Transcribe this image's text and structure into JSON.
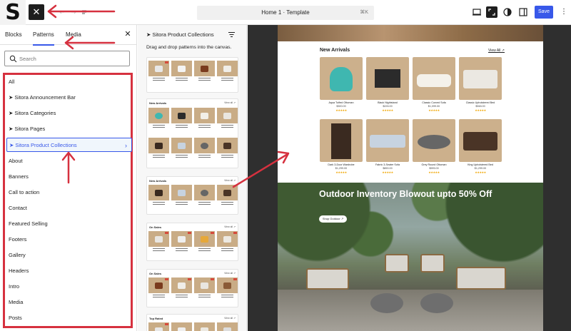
{
  "topbar": {
    "logo_letter": "S",
    "close_glyph": "✕",
    "document_title": "Home 1 · Template",
    "shortcut": "⌘K",
    "save_label": "Save",
    "more_glyph": "⋮",
    "icons": [
      "view-desktop-icon",
      "zoom-out-icon",
      "styles-icon",
      "settings-sidebar-icon"
    ]
  },
  "inserter": {
    "tabs": [
      {
        "label": "Blocks",
        "active": false
      },
      {
        "label": "Patterns",
        "active": true
      },
      {
        "label": "Media",
        "active": false
      }
    ],
    "close_glyph": "✕",
    "search": {
      "placeholder": "Search",
      "value": ""
    },
    "categories": [
      {
        "label": "All"
      },
      {
        "label": "➤ Sitora Announcement Bar"
      },
      {
        "label": "➤ Sitora Categories"
      },
      {
        "label": "➤ Sitora Pages"
      },
      {
        "label": "➤ Sitora Product Collections",
        "selected": true
      },
      {
        "label": "About"
      },
      {
        "label": "Banners"
      },
      {
        "label": "Call to action"
      },
      {
        "label": "Contact"
      },
      {
        "label": "Featured Selling"
      },
      {
        "label": "Footers"
      },
      {
        "label": "Gallery"
      },
      {
        "label": "Headers"
      },
      {
        "label": "Intro"
      },
      {
        "label": "Media"
      },
      {
        "label": "Posts"
      }
    ],
    "chevron_glyph": "›"
  },
  "patterns_panel": {
    "title": "➤ Sitora Product Collections",
    "help_text": "Drag and drop patterns into the canvas.",
    "cards": [
      {
        "title": "",
        "link": ""
      },
      {
        "title": "New Arrivals",
        "link": "View all ↗"
      },
      {
        "title": "New Arrivals",
        "link": "View all ↗"
      },
      {
        "title": "On Sales",
        "link": "View all ↗"
      },
      {
        "title": "On Sales",
        "link": "View all ↗"
      },
      {
        "title": "Top Rated",
        "link": "View all ↗"
      }
    ]
  },
  "canvas": {
    "new_arrivals": {
      "title": "New Arrivals",
      "view_all": "View All ↗",
      "products": [
        {
          "name": "Aqua Tufted Ottoman",
          "price": "$300.00",
          "stars": "★★★★★"
        },
        {
          "name": "Black Nightstand",
          "price": "$226.00",
          "stars": "★★★★★"
        },
        {
          "name": "Classic Curved Sofa",
          "price": "$1,099.00",
          "stars": "★★★★★"
        },
        {
          "name": "Classic Upholstered Bed",
          "price": "$948.00",
          "stars": "★★★★★"
        },
        {
          "name": "Dark 3-Door Wardrobe",
          "price": "$1,299.00",
          "stars": "★★★★★"
        },
        {
          "name": "Fabric 3-Seater Sofa",
          "price": "$890.00",
          "stars": "★★★★★"
        },
        {
          "name": "Grey Round Ottoman",
          "price": "$995.00",
          "stars": "★★★★★"
        },
        {
          "name": "King Upholstered Bed",
          "price": "$1,299.00",
          "stars": "★★★★★"
        }
      ]
    },
    "outdoor": {
      "headline": "Outdoor Inventory Blowout upto 50% Off",
      "button": "Shop Outdoor ↗"
    }
  },
  "colors": {
    "accent": "#3858e9",
    "annotation": "#d6313f",
    "star": "#f0a500"
  }
}
